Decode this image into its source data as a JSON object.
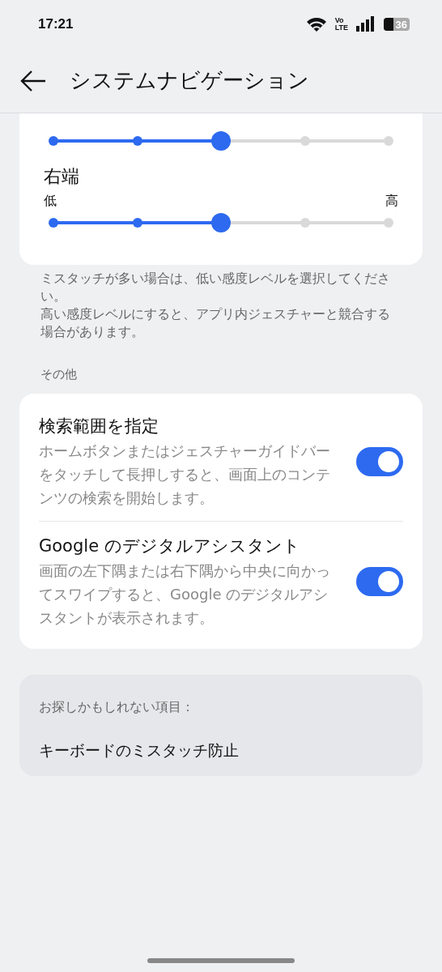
{
  "status_bar": {
    "time": "17:21",
    "volte_top": "Vo",
    "volte_bottom": "LTE",
    "battery": "36"
  },
  "header": {
    "title": "システムナビゲーション"
  },
  "sliders": [
    {
      "level": 0.5
    },
    {
      "label": "右端",
      "low": "低",
      "high": "高",
      "level": 0.5
    }
  ],
  "hint": [
    "ミスタッチが多い場合は、低い感度レベルを選択してください。",
    "高い感度レベルにすると、アプリ内ジェスチャーと競合する場合があります。"
  ],
  "section_title": "その他",
  "toggles": [
    {
      "title": "検索範囲を指定",
      "description": "ホームボタンまたはジェスチャーガイドバーをタッチして長押しすると、画面上のコンテンツの検索を開始します。",
      "on": true
    },
    {
      "title": "Google のデジタルアシスタント",
      "description": "画面の左下隅または右下隅から中央に向かってスワイプすると、Google のデジタルアシスタントが表示されます。",
      "on": true
    }
  ],
  "suggestions": {
    "title": "お探しかもしれない項目：",
    "items": [
      "キーボードのミスタッチ防止"
    ]
  }
}
